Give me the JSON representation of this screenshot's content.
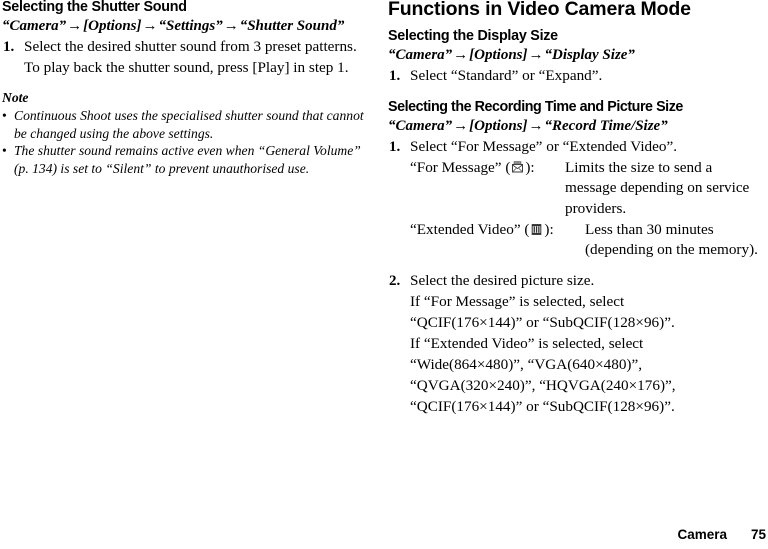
{
  "page": {
    "footer_chapter": "Camera",
    "footer_page": "75"
  },
  "left_column": {
    "section_heading": "Selecting the Shutter Sound",
    "nav_path": {
      "parts": [
        "“Camera”",
        "[Options]",
        "“Settings”",
        "“Shutter Sound”"
      ],
      "arrow": "→"
    },
    "step1": {
      "number": "1.",
      "line1": "Select the desired shutter sound from 3 preset patterns.",
      "line2": "To play back the shutter sound, press [Play] in step 1."
    },
    "note": {
      "title": "Note",
      "bullet": "•",
      "items": [
        "Continuous Shoot uses the specialised shutter sound that cannot be changed using the above settings.",
        "The shutter sound remains active even when “General Volume” (p. 134) is set to “Silent” to prevent unauthorised use."
      ]
    }
  },
  "right_column": {
    "chapter_heading": "Functions in Video Camera Mode",
    "display_size": {
      "section_heading": "Selecting the Display Size",
      "nav_path": {
        "parts": [
          "“Camera”",
          "[Options]",
          "“Display Size”"
        ],
        "arrow": "→"
      },
      "step1": {
        "number": "1.",
        "text": "Select “Standard” or “Expand”."
      }
    },
    "record_time_size": {
      "section_heading": "Selecting the Recording Time and Picture Size",
      "nav_path": {
        "parts": [
          "“Camera”",
          "[Options]",
          "“Record Time/Size”"
        ],
        "arrow": "→"
      },
      "step1": {
        "number": "1.",
        "text": "Select “For Message” or “Extended Video”.",
        "definitions": [
          {
            "term_prefix": "“For Message” (",
            "icon": "envelope-message-icon",
            "term_suffix": "):",
            "description": "Limits the size to send a message depending on service providers."
          },
          {
            "term_prefix": "“Extended Video” (",
            "icon": "film-strip-video-icon",
            "term_suffix": "):",
            "description": "Less than 30 minutes (depending on the memory)."
          }
        ]
      },
      "step2": {
        "number": "2.",
        "text": "Select the desired picture size.",
        "detail_lines": [
          "If “For Message” is selected, select",
          "“QCIF(176×144)” or “SubQCIF(128×96)”.",
          "If “Extended Video” is selected, select",
          "“Wide(864×480)”, “VGA(640×480)”,",
          "“QVGA(320×240)”, “HQVGA(240×176)”,",
          "“QCIF(176×144)” or “SubQCIF(128×96)”."
        ]
      }
    }
  }
}
